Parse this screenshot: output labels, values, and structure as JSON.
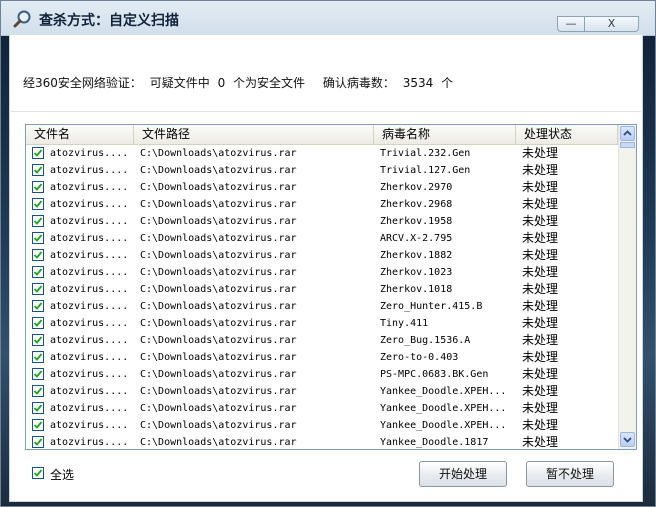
{
  "window": {
    "title": "查杀方式：自定义扫描",
    "minimize_label": "—",
    "close_label": "X"
  },
  "summary": {
    "verify_label": "经360安全网络验证：",
    "suspicious_prefix": "可疑文件中",
    "safe_count": "0",
    "safe_suffix": "个为安全文件",
    "confirmed_label": "确认病毒数：",
    "virus_count": "3534",
    "virus_unit": "个"
  },
  "table": {
    "columns": [
      "文件名",
      "文件路径",
      "病毒名称",
      "处理状态"
    ],
    "rows": [
      {
        "name": "atozvirus....",
        "path": "C:\\Downloads\\atozvirus.rar",
        "virus": "Trivial.232.Gen",
        "status": "未处理",
        "checked": true
      },
      {
        "name": "atozvirus....",
        "path": "C:\\Downloads\\atozvirus.rar",
        "virus": "Trivial.127.Gen",
        "status": "未处理",
        "checked": true
      },
      {
        "name": "atozvirus....",
        "path": "C:\\Downloads\\atozvirus.rar",
        "virus": "Zherkov.2970",
        "status": "未处理",
        "checked": true
      },
      {
        "name": "atozvirus....",
        "path": "C:\\Downloads\\atozvirus.rar",
        "virus": "Zherkov.2968",
        "status": "未处理",
        "checked": true
      },
      {
        "name": "atozvirus....",
        "path": "C:\\Downloads\\atozvirus.rar",
        "virus": "Zherkov.1958",
        "status": "未处理",
        "checked": true
      },
      {
        "name": "atozvirus....",
        "path": "C:\\Downloads\\atozvirus.rar",
        "virus": "ARCV.X-2.795",
        "status": "未处理",
        "checked": true
      },
      {
        "name": "atozvirus....",
        "path": "C:\\Downloads\\atozvirus.rar",
        "virus": "Zherkov.1882",
        "status": "未处理",
        "checked": true
      },
      {
        "name": "atozvirus....",
        "path": "C:\\Downloads\\atozvirus.rar",
        "virus": "Zherkov.1023",
        "status": "未处理",
        "checked": true
      },
      {
        "name": "atozvirus....",
        "path": "C:\\Downloads\\atozvirus.rar",
        "virus": "Zherkov.1018",
        "status": "未处理",
        "checked": true
      },
      {
        "name": "atozvirus....",
        "path": "C:\\Downloads\\atozvirus.rar",
        "virus": "Zero_Hunter.415.B",
        "status": "未处理",
        "checked": true
      },
      {
        "name": "atozvirus....",
        "path": "C:\\Downloads\\atozvirus.rar",
        "virus": "Tiny.411",
        "status": "未处理",
        "checked": true
      },
      {
        "name": "atozvirus....",
        "path": "C:\\Downloads\\atozvirus.rar",
        "virus": "Zero_Bug.1536.A",
        "status": "未处理",
        "checked": true
      },
      {
        "name": "atozvirus....",
        "path": "C:\\Downloads\\atozvirus.rar",
        "virus": "Zero-to-0.403",
        "status": "未处理",
        "checked": true
      },
      {
        "name": "atozvirus....",
        "path": "C:\\Downloads\\atozvirus.rar",
        "virus": "PS-MPC.0683.BK.Gen",
        "status": "未处理",
        "checked": true
      },
      {
        "name": "atozvirus....",
        "path": "C:\\Downloads\\atozvirus.rar",
        "virus": "Yankee_Doodle.XPEH...",
        "status": "未处理",
        "checked": true
      },
      {
        "name": "atozvirus....",
        "path": "C:\\Downloads\\atozvirus.rar",
        "virus": "Yankee_Doodle.XPEH...",
        "status": "未处理",
        "checked": true
      },
      {
        "name": "atozvirus....",
        "path": "C:\\Downloads\\atozvirus.rar",
        "virus": "Yankee_Doodle.XPEH...",
        "status": "未处理",
        "checked": true
      },
      {
        "name": "atozvirus....",
        "path": "C:\\Downloads\\atozvirus.rar",
        "virus": "Yankee_Doodle.1817",
        "status": "未处理",
        "checked": true
      }
    ]
  },
  "footer": {
    "select_all_label": "全选",
    "select_all_checked": true,
    "start_button": "开始处理",
    "skip_button": "暂不处理"
  },
  "icons": {
    "title_icon": "magnifier-icon",
    "checkbox_check": "checkmark-icon"
  },
  "colors": {
    "title_bar": "#d8e4ef",
    "checkmark": "#21a121",
    "list_border": "#7f9db9"
  }
}
